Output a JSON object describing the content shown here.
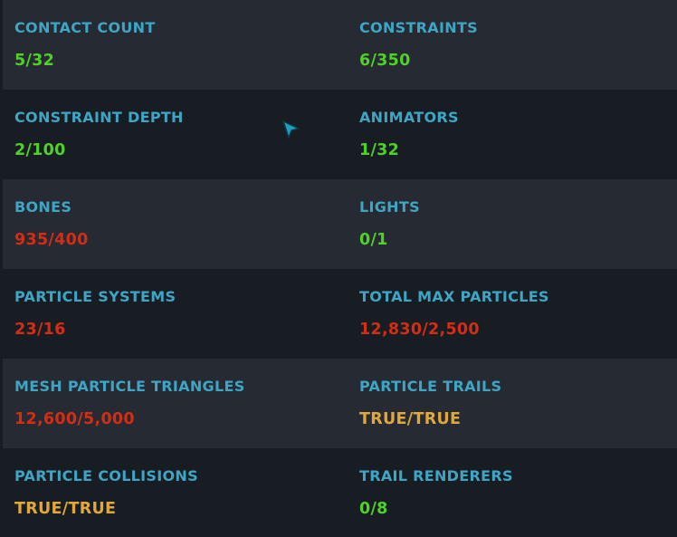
{
  "stats": [
    {
      "left": {
        "label": "CONTACT COUNT",
        "value": "5/32",
        "status": "ok"
      },
      "right": {
        "label": "CONSTRAINTS",
        "value": "6/350",
        "status": "ok"
      }
    },
    {
      "left": {
        "label": "CONSTRAINT DEPTH",
        "value": "2/100",
        "status": "ok"
      },
      "right": {
        "label": "ANIMATORS",
        "value": "1/32",
        "status": "ok"
      }
    },
    {
      "left": {
        "label": "BONES",
        "value": "935/400",
        "status": "over"
      },
      "right": {
        "label": "LIGHTS",
        "value": "0/1",
        "status": "ok"
      }
    },
    {
      "left": {
        "label": "PARTICLE SYSTEMS",
        "value": "23/16",
        "status": "over"
      },
      "right": {
        "label": "TOTAL MAX PARTICLES",
        "value": "12,830/2,500",
        "status": "over"
      }
    },
    {
      "left": {
        "label": "MESH PARTICLE TRIANGLES",
        "value": "12,600/5,000",
        "status": "over"
      },
      "right": {
        "label": "PARTICLE TRAILS",
        "value": "TRUE/TRUE",
        "status": "warn"
      }
    },
    {
      "left": {
        "label": "PARTICLE COLLISIONS",
        "value": "TRUE/TRUE",
        "status": "warn"
      },
      "right": {
        "label": "TRAIL RENDERERS",
        "value": "0/8",
        "status": "ok"
      }
    }
  ],
  "colors": {
    "background": "#181d24",
    "row_alt": "#252a33",
    "label": "#3ea6c4",
    "ok": "#4fd127",
    "over": "#d32d14",
    "warn": "#e0a83a"
  },
  "cursor_icon": "arrow-pointer-icon"
}
